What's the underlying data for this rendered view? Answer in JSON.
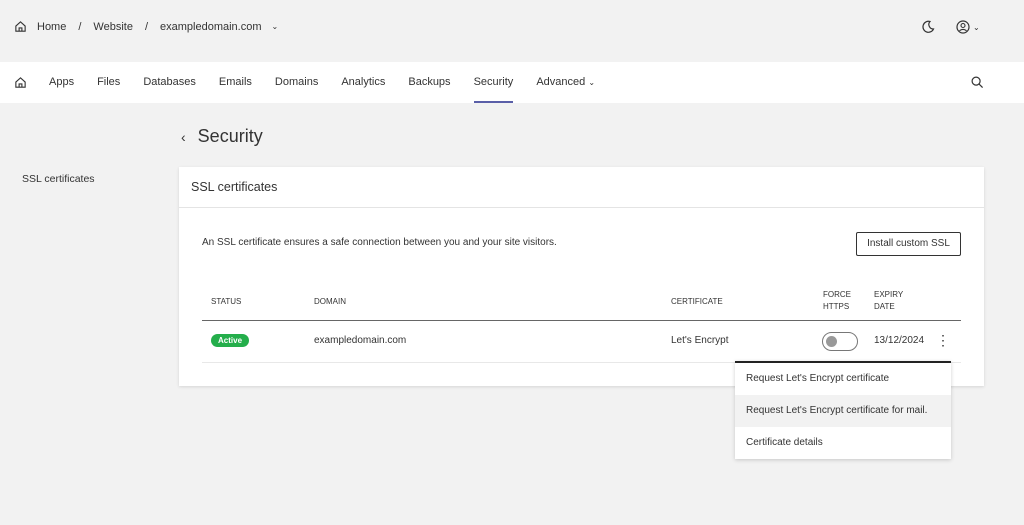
{
  "breadcrumb": {
    "items": [
      "Home",
      "Website",
      "exampledomain.com"
    ],
    "separator": "/"
  },
  "header": {
    "icons": [
      "moon-icon",
      "user-icon"
    ]
  },
  "nav": {
    "tabs": [
      {
        "label": "Apps"
      },
      {
        "label": "Files"
      },
      {
        "label": "Databases"
      },
      {
        "label": "Emails"
      },
      {
        "label": "Domains"
      },
      {
        "label": "Analytics"
      },
      {
        "label": "Backups"
      },
      {
        "label": "Security",
        "active": true
      },
      {
        "label": "Advanced"
      }
    ]
  },
  "page": {
    "title": "Security"
  },
  "sidebar": {
    "items": [
      {
        "label": "SSL certificates"
      }
    ]
  },
  "card": {
    "title": "SSL certificates",
    "description": "An SSL certificate ensures a safe connection between you and your site visitors.",
    "install_button": "Install custom SSL"
  },
  "table": {
    "headers": {
      "status": "STATUS",
      "domain": "DOMAIN",
      "certificate": "CERTIFICATE",
      "force1": "FORCE",
      "force2": "HTTPS",
      "expiry1": "EXPIRY",
      "expiry2": "DATE"
    },
    "rows": [
      {
        "status": "Active",
        "domain": "exampledomain.com",
        "certificate": "Let's Encrypt",
        "force_https": false,
        "expiry": "13/12/2024"
      }
    ]
  },
  "menu": {
    "items": [
      "Request Let's Encrypt certificate",
      "Request Let's Encrypt certificate for mail.",
      "Certificate details"
    ]
  },
  "colors": {
    "accent": "#5a5fa8",
    "active_badge": "#24ae4b"
  }
}
